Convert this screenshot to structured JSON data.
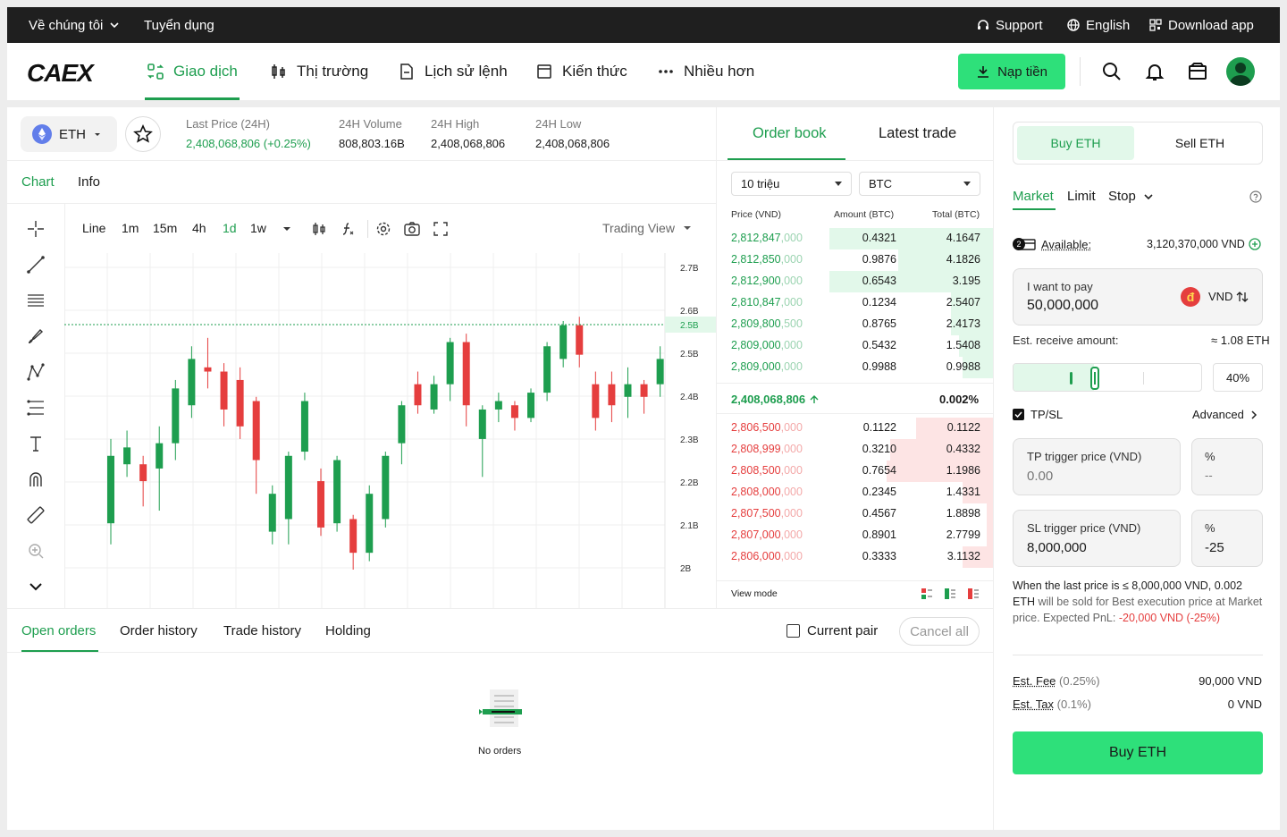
{
  "topbar": {
    "about": "Về chúng tôi",
    "careers": "Tuyển dụng",
    "support": "Support",
    "language": "English",
    "download": "Download app"
  },
  "header": {
    "logo": "CAEX",
    "nav": [
      "Giao dịch",
      "Thị trường",
      "Lịch sử lệnh",
      "Kiến thức",
      "Nhiều hơn"
    ],
    "deposit_label": "Nạp tiền"
  },
  "ticker": {
    "symbol": "ETH",
    "last_price_label": "Last Price (24H)",
    "last_price": "2,408,068,806 (+0.25%)",
    "volume_label": "24H Volume",
    "volume": "808,803.16B",
    "high_label": "24H High",
    "high": "2,408,068,806",
    "low_label": "24H Low",
    "low": "2,408,068,806"
  },
  "chart_tabs": [
    "Chart",
    "Info"
  ],
  "chart_toolbar": {
    "intervals": [
      "Line",
      "1m",
      "15m",
      "4h",
      "1d",
      "1w"
    ],
    "active_interval": "1d",
    "view": "Trading View"
  },
  "chart_data": {
    "type": "candlestick",
    "y_ticks": [
      "2.7B",
      "2.6B",
      "2.5B",
      "2.5B",
      "2.4B",
      "2.3B",
      "2.2B",
      "2.1B",
      "2B"
    ],
    "current_price_tag": "2.5B",
    "ylim": [
      1.95,
      2.75
    ],
    "candles": [
      {
        "o": 2.13,
        "c": 2.29,
        "h": 2.33,
        "l": 2.08
      },
      {
        "o": 2.27,
        "c": 2.31,
        "h": 2.35,
        "l": 2.24
      },
      {
        "o": 2.27,
        "c": 2.23,
        "h": 2.29,
        "l": 2.17
      },
      {
        "o": 2.26,
        "c": 2.32,
        "h": 2.36,
        "l": 2.16
      },
      {
        "o": 2.32,
        "c": 2.45,
        "h": 2.47,
        "l": 2.28
      },
      {
        "o": 2.41,
        "c": 2.52,
        "h": 2.55,
        "l": 2.38
      },
      {
        "o": 2.5,
        "c": 2.49,
        "h": 2.57,
        "l": 2.45
      },
      {
        "o": 2.49,
        "c": 2.4,
        "h": 2.51,
        "l": 2.36
      },
      {
        "o": 2.47,
        "c": 2.36,
        "h": 2.5,
        "l": 2.33
      },
      {
        "o": 2.42,
        "c": 2.28,
        "h": 2.43,
        "l": 2.2
      },
      {
        "o": 2.11,
        "c": 2.2,
        "h": 2.22,
        "l": 2.08
      },
      {
        "o": 2.14,
        "c": 2.29,
        "h": 2.3,
        "l": 2.08
      },
      {
        "o": 2.3,
        "c": 2.42,
        "h": 2.44,
        "l": 2.28
      },
      {
        "o": 2.23,
        "c": 2.12,
        "h": 2.26,
        "l": 2.1
      },
      {
        "o": 2.13,
        "c": 2.28,
        "h": 2.29,
        "l": 2.11
      },
      {
        "o": 2.14,
        "c": 2.06,
        "h": 2.15,
        "l": 2.02
      },
      {
        "o": 2.06,
        "c": 2.2,
        "h": 2.22,
        "l": 2.04
      },
      {
        "o": 2.14,
        "c": 2.29,
        "h": 2.3,
        "l": 2.12
      },
      {
        "o": 2.32,
        "c": 2.41,
        "h": 2.42,
        "l": 2.27
      },
      {
        "o": 2.46,
        "c": 2.41,
        "h": 2.49,
        "l": 2.39
      },
      {
        "o": 2.4,
        "c": 2.46,
        "h": 2.48,
        "l": 2.39
      },
      {
        "o": 2.46,
        "c": 2.56,
        "h": 2.57,
        "l": 2.42
      },
      {
        "o": 2.56,
        "c": 2.41,
        "h": 2.58,
        "l": 2.36
      },
      {
        "o": 2.33,
        "c": 2.4,
        "h": 2.41,
        "l": 2.24
      },
      {
        "o": 2.4,
        "c": 2.42,
        "h": 2.44,
        "l": 2.37
      },
      {
        "o": 2.41,
        "c": 2.38,
        "h": 2.42,
        "l": 2.35
      },
      {
        "o": 2.38,
        "c": 2.44,
        "h": 2.45,
        "l": 2.37
      },
      {
        "o": 2.44,
        "c": 2.55,
        "h": 2.56,
        "l": 2.42
      },
      {
        "o": 2.52,
        "c": 2.6,
        "h": 2.61,
        "l": 2.5
      },
      {
        "o": 2.6,
        "c": 2.53,
        "h": 2.62,
        "l": 2.5
      },
      {
        "o": 2.46,
        "c": 2.38,
        "h": 2.49,
        "l": 2.35
      },
      {
        "o": 2.46,
        "c": 2.41,
        "h": 2.49,
        "l": 2.37
      },
      {
        "o": 2.43,
        "c": 2.46,
        "h": 2.5,
        "l": 2.38
      },
      {
        "o": 2.46,
        "c": 2.43,
        "h": 2.47,
        "l": 2.39
      },
      {
        "o": 2.46,
        "c": 2.52,
        "h": 2.55,
        "l": 2.43
      }
    ]
  },
  "orderbook": {
    "tabs": [
      "Order book",
      "Latest trade"
    ],
    "group": "10 triệu",
    "unit": "BTC",
    "headers": [
      "Price (VND)",
      "Amount (BTC)",
      "Total (BTC)"
    ],
    "bids": [
      {
        "p1": "2,812,847",
        ",p2": "",
        "p2x": ",000",
        "price_main": "2,812,847",
        "price_tail": ",000",
        "amount": "0.4321",
        "total": "4.1647",
        "depth": 0.95
      },
      {
        "price_main": "2,812,850",
        "price_tail": ",000",
        "amount": "0.9876",
        "total": "4.1826",
        "depth": 0.55
      },
      {
        "price_main": "2,812,900",
        "price_tail": ",000",
        "amount": "0.6543",
        "total": "3.195",
        "depth": 0.95
      },
      {
        "price_main": "2,810,847",
        "price_tail": ",000",
        "amount": "0.1234",
        "total": "2.5407",
        "depth": 0.25
      },
      {
        "price_main": "2,809,800",
        "price_tail": ",500",
        "amount": "0.8765",
        "total": "2.4173",
        "depth": 0.25
      },
      {
        "price_main": "2,809,000",
        "price_tail": ",000",
        "amount": "0.5432",
        "total": "1.5408",
        "depth": 0.2
      },
      {
        "price_main": "2,809,000",
        "price_tail": ",000",
        "amount": "0.9988",
        "total": "0.9988",
        "depth": 0.18
      }
    ],
    "mid_price": "2,408,068,806",
    "mid_change": "0.002%",
    "asks": [
      {
        "price_main": "2,806,500",
        "price_tail": ",000",
        "amount": "0.1122",
        "total": "0.1122",
        "depth": 0.45
      },
      {
        "price_main": "2,808,999",
        "price_tail": ",000",
        "amount": "0.3210",
        "total": "0.4332",
        "depth": 0.6
      },
      {
        "price_main": "2,808,500",
        "price_tail": ",000",
        "amount": "0.7654",
        "total": "1.1986",
        "depth": 0.62
      },
      {
        "price_main": "2,808,000",
        "price_tail": ",000",
        "amount": "0.2345",
        "total": "1.4331",
        "depth": 0.18
      },
      {
        "price_main": "2,807,500",
        "price_tail": ",000",
        "amount": "0.4567",
        "total": "1.8898",
        "depth": 0.04
      },
      {
        "price_main": "2,807,000",
        "price_tail": ",000",
        "amount": "0.8901",
        "total": "2.7799",
        "depth": 0.04
      },
      {
        "price_main": "2,806,000",
        "price_tail": ",000",
        "amount": "0.3333",
        "total": "3.1132",
        "depth": 0.18
      }
    ],
    "view_mode": "View mode"
  },
  "orders": {
    "tabs": [
      "Open orders",
      "Order history",
      "Trade history",
      "Holding"
    ],
    "current_pair": "Current pair",
    "cancel_all": "Cancel all",
    "empty": "No orders"
  },
  "trade": {
    "buy_tab": "Buy ETH",
    "sell_tab": "Sell ETH",
    "types": [
      "Market",
      "Limit",
      "Stop"
    ],
    "available_label": "Available:",
    "available_value": "3,120,370,000 VND",
    "wallet_badge": "2",
    "pay_label": "I want to pay",
    "pay_value": "50,000,000",
    "pay_currency": "VND",
    "currency_glyph": "đ",
    "receive_label": "Est. receive amount:",
    "receive_value": "≈ 1.08 ETH",
    "slider_percent": "40%",
    "slider_fraction": 0.4,
    "tpsl_label": "TP/SL",
    "advanced": "Advanced",
    "tp_label": "TP trigger price (VND)",
    "tp_value": "0.00",
    "tp_pct_label": "%",
    "tp_pct_value": "--",
    "sl_label": "SL trigger price (VND)",
    "sl_value": "8,000,000",
    "sl_pct_label": "%",
    "sl_pct_value": "-25",
    "note_part1": "When the last price is ≤ 8,000,000 VND, 0.002 ETH",
    "note_part2": " will be sold for Best execution price at Market price. ",
    "note_part3": "Expected PnL: ",
    "note_pnl": "-20,000 VND (-25%)",
    "fee_label": "Est. Fee",
    "fee_rate": "(0.25%)",
    "fee_value": "90,000 VND",
    "tax_label": "Est. Tax",
    "tax_rate": "(0.1%)",
    "tax_value": "0 VND",
    "submit": "Buy ETH"
  },
  "colors": {
    "accent": "#1e9e4f",
    "up": "#1e9e4f",
    "down": "#e53e3e",
    "cta": "#2ee07a"
  }
}
